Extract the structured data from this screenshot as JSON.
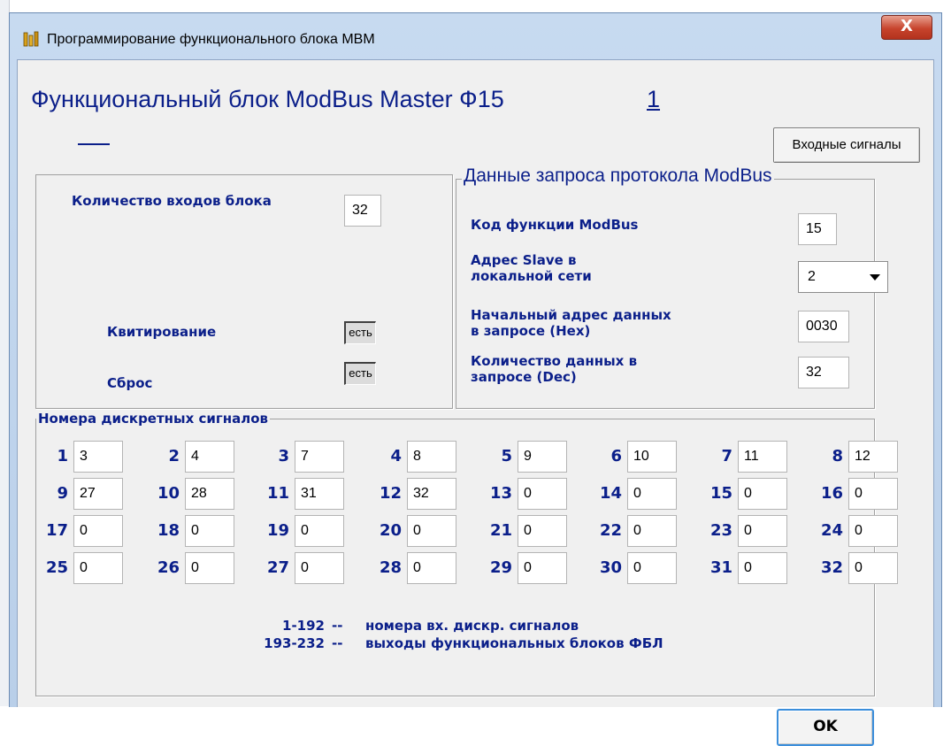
{
  "window": {
    "title": "Программирование функционального блока МВМ",
    "close_glyph": "X"
  },
  "main": {
    "heading": "Функциональный блок ModBus Master  Ф15",
    "heading_link": "1",
    "inputs_button": "Входные сигналы",
    "ok_button": "OK"
  },
  "block": {
    "inputs_label": "Количество  входов блока",
    "inputs_value": "32",
    "ack_label": "Квитирование",
    "ack_value": "есть",
    "reset_label": "Сброс",
    "reset_value": "есть"
  },
  "modbus": {
    "legend": "Данные запроса протокола ModBus",
    "func_label": "Код функции    ModBus",
    "func_value": "15",
    "slave_label": "Адрес Slave в локальной  сети",
    "slave_value": "2",
    "start_label": "Начальный адрес данных в запросе (Hex)",
    "start_value": "0030",
    "count_label": "Количество  данных в запросе  (Dec)",
    "count_value": "32"
  },
  "signals": {
    "legend": "Номера  дискретных сигналов",
    "items": [
      {
        "num": "1",
        "value": "3"
      },
      {
        "num": "2",
        "value": "4"
      },
      {
        "num": "3",
        "value": "7"
      },
      {
        "num": "4",
        "value": "8"
      },
      {
        "num": "5",
        "value": "9"
      },
      {
        "num": "6",
        "value": "10"
      },
      {
        "num": "7",
        "value": "11"
      },
      {
        "num": "8",
        "value": "12"
      },
      {
        "num": "9",
        "value": "27"
      },
      {
        "num": "10",
        "value": "28"
      },
      {
        "num": "11",
        "value": "31"
      },
      {
        "num": "12",
        "value": "32"
      },
      {
        "num": "13",
        "value": "0"
      },
      {
        "num": "14",
        "value": "0"
      },
      {
        "num": "15",
        "value": "0"
      },
      {
        "num": "16",
        "value": "0"
      },
      {
        "num": "17",
        "value": "0"
      },
      {
        "num": "18",
        "value": "0"
      },
      {
        "num": "19",
        "value": "0"
      },
      {
        "num": "20",
        "value": "0"
      },
      {
        "num": "21",
        "value": "0"
      },
      {
        "num": "22",
        "value": "0"
      },
      {
        "num": "23",
        "value": "0"
      },
      {
        "num": "24",
        "value": "0"
      },
      {
        "num": "25",
        "value": "0"
      },
      {
        "num": "26",
        "value": "0"
      },
      {
        "num": "27",
        "value": "0"
      },
      {
        "num": "28",
        "value": "0"
      },
      {
        "num": "29",
        "value": "0"
      },
      {
        "num": "30",
        "value": "0"
      },
      {
        "num": "31",
        "value": "0"
      },
      {
        "num": "32",
        "value": "0"
      }
    ],
    "note_range_1": "1-192",
    "note_sep_1": "--",
    "note_text_1": "номера вх. дискр. сигналов",
    "note_range_2": "193-232",
    "note_sep_2": "--",
    "note_text_2": "выходы функциональных блоков ФБЛ"
  },
  "colors": {
    "label_blue": "#0b1f8a",
    "title_bar": "#c7daf0",
    "close_red": "#c7442d",
    "ok_focus": "#3b8edb"
  }
}
